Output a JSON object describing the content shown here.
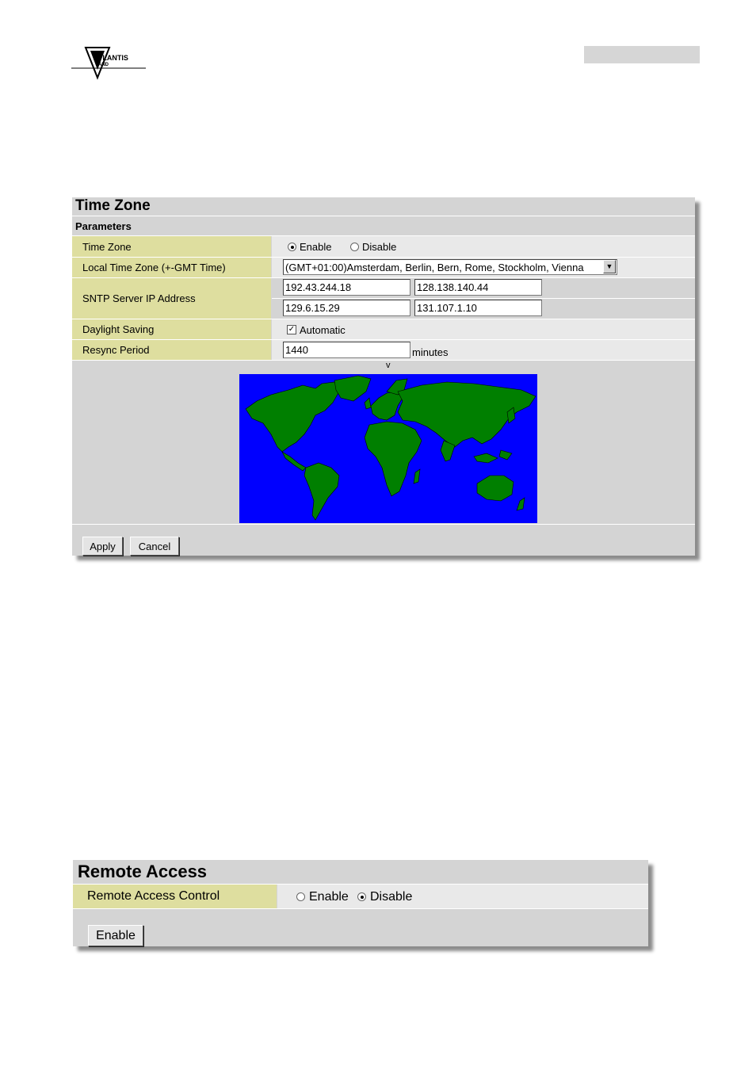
{
  "header": {
    "logo_text": "ATLANTIS",
    "logo_sub": "AND"
  },
  "timezone_panel": {
    "title": "Time Zone",
    "section": "Parameters",
    "rows": {
      "time_zone": {
        "label": "Time Zone",
        "opt_enable": "Enable",
        "opt_disable": "Disable",
        "selected": "Enable"
      },
      "local_tz": {
        "label": "Local Time Zone (+-GMT Time)",
        "value": "(GMT+01:00)Amsterdam, Berlin, Bern, Rome, Stockholm, Vienna"
      },
      "sntp": {
        "label": "SNTP Server IP Address",
        "servers": [
          "192.43.244.18",
          "128.138.140.44",
          "129.6.15.29",
          "131.107.1.10"
        ]
      },
      "daylight": {
        "label": "Daylight Saving",
        "checkbox_label": "Automatic",
        "checked": true
      },
      "resync": {
        "label": "Resync Period",
        "value": "1440",
        "unit": "minutes"
      }
    },
    "map_marker": "v",
    "colors": {
      "ocean": "#0000ff",
      "land": "#007f00",
      "label_bg": "#dede9f"
    },
    "apply_label": "Apply",
    "cancel_label": "Cancel"
  },
  "remote_panel": {
    "title": "Remote Access",
    "row_label": "Remote Access Control",
    "opt_enable": "Enable",
    "opt_disable": "Disable",
    "selected": "Disable",
    "button_label": "Enable"
  }
}
